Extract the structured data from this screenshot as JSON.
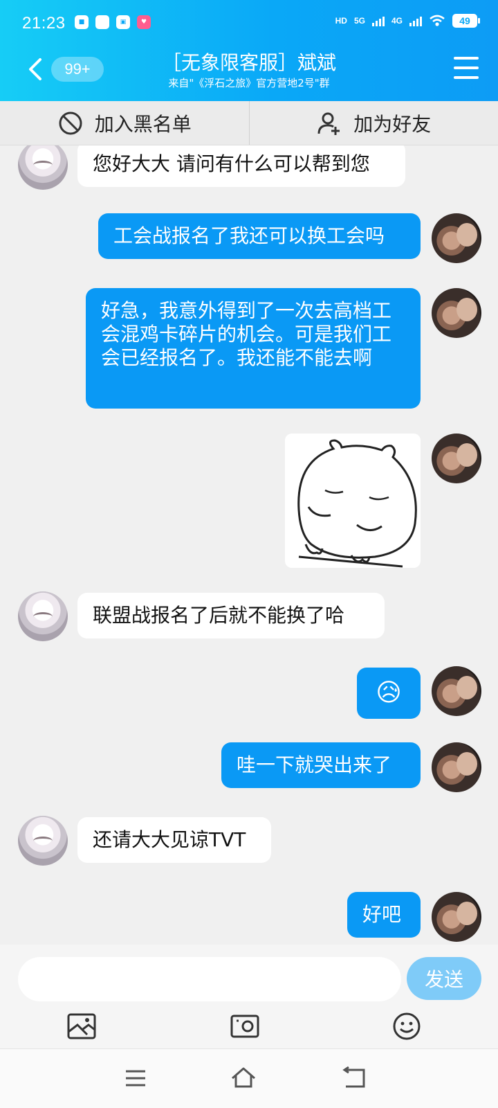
{
  "status_bar": {
    "time": "21:23",
    "network_labels": [
      "HD",
      "5G",
      "4G"
    ],
    "battery": "49"
  },
  "header": {
    "unread_count": "99+",
    "title": "［无象限客服］斌斌",
    "subtitle": "来自\"《浮石之旅》官方营地2号\"群"
  },
  "actions": {
    "blacklist": "加入黑名单",
    "add_friend": "加为好友"
  },
  "messages": [
    {
      "from": "agent",
      "text": "您好大大 请问有什么可以帮到您"
    },
    {
      "from": "me",
      "text": "工会战报名了我还可以换工会吗"
    },
    {
      "from": "me",
      "text": "好急，我意外得到了一次去高档工会混鸡卡碎片的机会。可是我们工会已经报名了。我还能不能去啊"
    },
    {
      "from": "me",
      "type": "sticker"
    },
    {
      "from": "agent",
      "text": "联盟战报名了后就不能换了哈"
    },
    {
      "from": "me",
      "text": "😥"
    },
    {
      "from": "me",
      "text": "哇一下就哭出来了"
    },
    {
      "from": "agent",
      "text": "还请大大见谅TVT"
    },
    {
      "from": "me",
      "text": "好吧"
    }
  ],
  "input": {
    "value": "",
    "send_label": "发送"
  },
  "colors": {
    "header_start": "#16cdf6",
    "header_end": "#0d9cf5",
    "outgoing_bubble": "#0a99f5",
    "send_button": "#7fcbf8"
  }
}
